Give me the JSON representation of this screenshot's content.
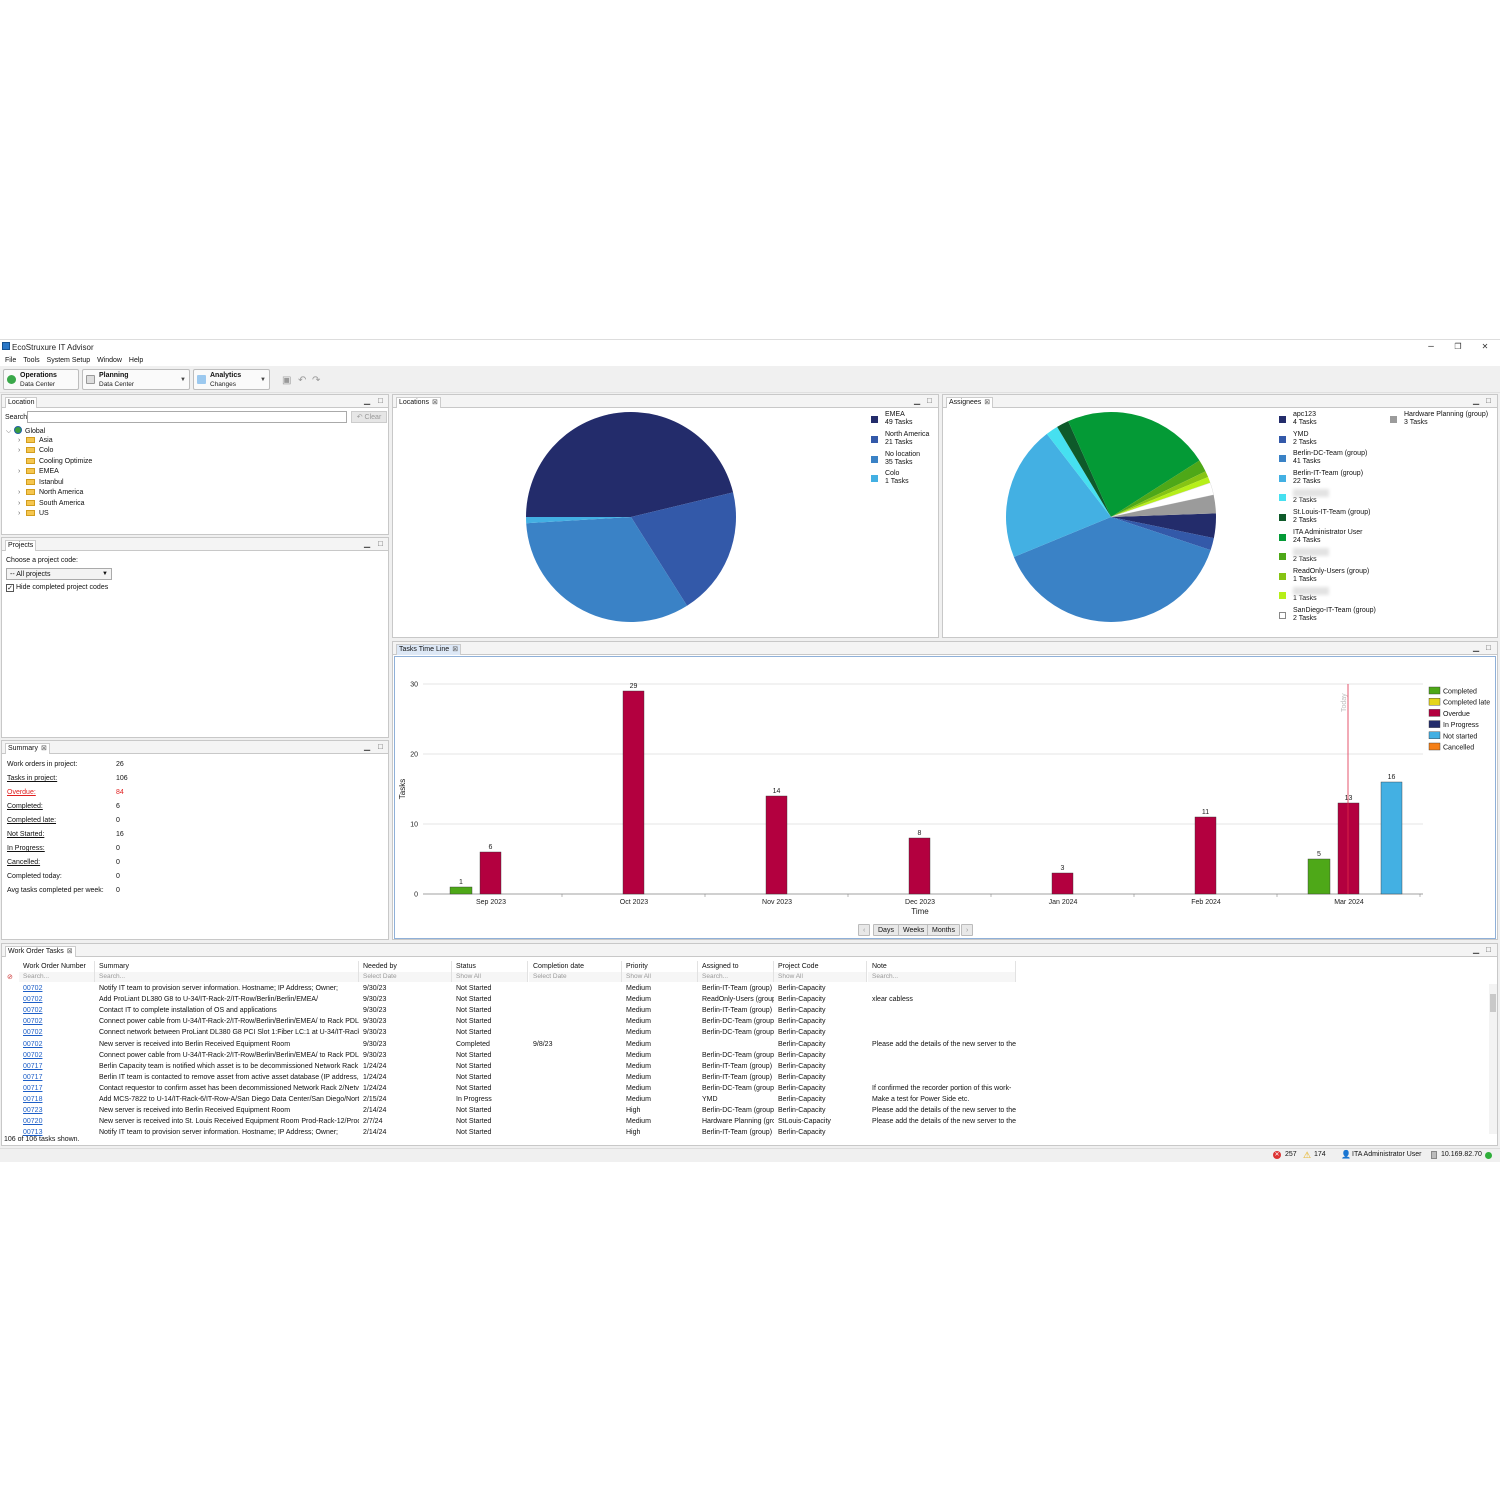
{
  "window": {
    "title": "EcoStruxure IT Advisor",
    "minimize": "–",
    "restore": "❐",
    "close": "✕"
  },
  "menu": [
    "File",
    "Tools",
    "System Setup",
    "Window",
    "Help"
  ],
  "perspectives": [
    {
      "title": "Operations",
      "subtitle": "Data Center",
      "color": "#3aa84a"
    },
    {
      "title": "Planning",
      "subtitle": "Data Center",
      "color": "#8a8a8a"
    },
    {
      "title": "Analytics",
      "subtitle": "Changes",
      "color": "#3d8fd6"
    }
  ],
  "location": {
    "tab": "Location",
    "search_label": "Search:",
    "search_value": "",
    "clear_label": "Clear",
    "tree": [
      {
        "label": "Global",
        "level": 0,
        "expanded": true
      },
      {
        "label": "Asia",
        "level": 1,
        "arrow": true
      },
      {
        "label": "Colo",
        "level": 1,
        "arrow": true
      },
      {
        "label": "Cooling Optimize",
        "level": 1,
        "arrow": false
      },
      {
        "label": "EMEA",
        "level": 1,
        "arrow": true
      },
      {
        "label": "Istanbul",
        "level": 1,
        "arrow": false
      },
      {
        "label": "North America",
        "level": 1,
        "arrow": true
      },
      {
        "label": "South America",
        "level": 1,
        "arrow": true
      },
      {
        "label": "US",
        "level": 1,
        "arrow": true
      }
    ]
  },
  "projects": {
    "tab": "Projects",
    "choose_label": "Choose a project code:",
    "select_value": "-- All projects",
    "hide_completed_label": "Hide completed project codes",
    "hide_completed_checked": true
  },
  "summary": {
    "tab": "Summary",
    "rows": [
      {
        "label": "Work orders in project:",
        "value": "26",
        "underline": false,
        "red": false
      },
      {
        "label": "Tasks in project:",
        "value": "106",
        "underline": true,
        "red": false
      },
      {
        "label": "Overdue:",
        "value": "84",
        "underline": true,
        "red": true
      },
      {
        "label": "Completed:",
        "value": "6",
        "underline": true,
        "red": false
      },
      {
        "label": "Completed late:",
        "value": "0",
        "underline": true,
        "red": false
      },
      {
        "label": "Not Started:",
        "value": "16",
        "underline": true,
        "red": false
      },
      {
        "label": "In Progress:",
        "value": "0",
        "underline": true,
        "red": false
      },
      {
        "label": "Cancelled:",
        "value": "0",
        "underline": true,
        "red": false
      },
      {
        "label": "Completed today:",
        "value": "0",
        "underline": false,
        "red": false
      },
      {
        "label": "Avg tasks completed per week:",
        "value": "0",
        "underline": false,
        "red": false
      }
    ]
  },
  "locations_chart": {
    "tab": "Locations",
    "legend": [
      {
        "name": "EMEA",
        "tasks": "49 Tasks",
        "value": 49,
        "color": "#232c6b"
      },
      {
        "name": "North America",
        "tasks": "21 Tasks",
        "value": 21,
        "color": "#3359a9"
      },
      {
        "name": "No location",
        "tasks": "35 Tasks",
        "value": 35,
        "color": "#3a82c6"
      },
      {
        "name": "Colo",
        "tasks": "1 Tasks",
        "value": 1,
        "color": "#43b0e3"
      }
    ]
  },
  "assignees_chart": {
    "tab": "Assignees",
    "legend": [
      {
        "name": "apc123",
        "tasks": "4 Tasks",
        "value": 4,
        "color": "#232c6b"
      },
      {
        "name": "YMD",
        "tasks": "2 Tasks",
        "value": 2,
        "color": "#3359a9"
      },
      {
        "name": "Berlin-DC-Team (group)",
        "tasks": "41 Tasks",
        "value": 41,
        "color": "#3a82c6"
      },
      {
        "name": "Berlin-IT-Team (group)",
        "tasks": "22 Tasks",
        "value": 22,
        "color": "#43b0e3"
      },
      {
        "name": "",
        "tasks": "2 Tasks",
        "value": 2,
        "color": "#46e0f0",
        "blurred": true
      },
      {
        "name": "St.Louis-IT-Team (group)",
        "tasks": "2 Tasks",
        "value": 2,
        "color": "#0e5a2a"
      },
      {
        "name": "ITA Administrator User",
        "tasks": "24 Tasks",
        "value": 24,
        "color": "#049a36"
      },
      {
        "name": "",
        "tasks": "2 Tasks",
        "value": 2,
        "color": "#4ea818",
        "blurred": true
      },
      {
        "name": "ReadOnly-Users (group)",
        "tasks": "1 Tasks",
        "value": 1,
        "color": "#86c414"
      },
      {
        "name": "",
        "tasks": "1 Tasks",
        "value": 1,
        "color": "#b6ef19",
        "blurred": true
      },
      {
        "name": "SanDiego-IT-Team (group)",
        "tasks": "2 Tasks",
        "value": 2,
        "color": "#ffffff"
      },
      {
        "name": "Hardware Planning (group)",
        "tasks": "3 Tasks",
        "value": 3,
        "color": "#9b9b9b"
      }
    ]
  },
  "timeline": {
    "tab": "Tasks Time Line",
    "today_label": "Today",
    "nav": {
      "prev": "‹",
      "next": "›",
      "days": "Days",
      "weeks": "Weeks",
      "months": "Months"
    }
  },
  "chart_data": {
    "type": "bar",
    "xlabel": "Time",
    "ylabel": "Tasks",
    "ylim": [
      0,
      30
    ],
    "yticks": [
      0,
      10,
      20,
      30
    ],
    "categories": [
      "Sep 2023",
      "Oct 2023",
      "Nov 2023",
      "Dec 2023",
      "Jan 2024",
      "Feb 2024",
      "Mar 2024"
    ],
    "bars": [
      {
        "month": "Sep 2023",
        "series": "Completed",
        "value": 1
      },
      {
        "month": "Sep 2023",
        "series": "Overdue",
        "value": 6
      },
      {
        "month": "Oct 2023",
        "series": "Overdue",
        "value": 29
      },
      {
        "month": "Nov 2023",
        "series": "Overdue",
        "value": 14
      },
      {
        "month": "Dec 2023",
        "series": "Overdue",
        "value": 8
      },
      {
        "month": "Jan 2024",
        "series": "Overdue",
        "value": 3
      },
      {
        "month": "Feb 2024",
        "series": "Overdue",
        "value": 11
      },
      {
        "month": "Mar 2024",
        "series": "Completed",
        "value": 5
      },
      {
        "month": "Mar 2024",
        "series": "Overdue",
        "value": 13
      },
      {
        "month": "Mar 2024",
        "series": "Not started",
        "value": 16
      }
    ],
    "legend": [
      {
        "name": "Completed",
        "color": "#4ea818"
      },
      {
        "name": "Completed late",
        "color": "#e5d51a"
      },
      {
        "name": "Overdue",
        "color": "#b3003f"
      },
      {
        "name": "In Progress",
        "color": "#232c6b"
      },
      {
        "name": "Not started",
        "color": "#43b0e3"
      },
      {
        "name": "Cancelled",
        "color": "#f57f17"
      }
    ],
    "legend_position": "right",
    "grid": true
  },
  "work_orders": {
    "tab": "Work Order Tasks",
    "columns": [
      "Work Order Number",
      "Summary",
      "Needed by",
      "Status",
      "Completion date",
      "Priority",
      "Assigned to",
      "Project Code",
      "Note"
    ],
    "filters": [
      "Search...",
      "Search...",
      "Select Date",
      "Show All",
      "Select Date",
      "Show All",
      "Search...",
      "Show All",
      "Search..."
    ],
    "rows": [
      [
        "00702",
        "Notify IT team to provision server information. Hostname; IP Address; Owner;",
        "9/30/23",
        "Not Started",
        "",
        "Medium",
        "Berlin-IT-Team (group)",
        "Berlin-Capacity",
        ""
      ],
      [
        "00702",
        "Add ProLiant DL380 G8 to U-34/IT-Rack-2/IT-Row/Berlin/Berlin/EMEA/",
        "9/30/23",
        "Not Started",
        "",
        "Medium",
        "ReadOnly-Users (group",
        "Berlin-Capacity",
        "xlear cabless"
      ],
      [
        "00702",
        "Contact IT to complete installation of OS and applications",
        "9/30/23",
        "Not Started",
        "",
        "Medium",
        "Berlin-IT-Team (group)",
        "Berlin-Capacity",
        ""
      ],
      [
        "00702",
        "Connect power cable from U-34/IT-Rack-2/IT-Row/Berlin/Berlin/EMEA/ to Rack PDL",
        "9/30/23",
        "Not Started",
        "",
        "Medium",
        "Berlin-DC-Team (group",
        "Berlin-Capacity",
        ""
      ],
      [
        "00702",
        "Connect network between ProLiant DL380 G8 PCI Slot 1:Fiber LC:1 at U-34/IT-Rack-2,",
        "9/30/23",
        "Not Started",
        "",
        "Medium",
        "Berlin-DC-Team (group",
        "Berlin-Capacity",
        ""
      ],
      [
        "00702",
        "New server is received into Berlin Received Equipment Room",
        "9/30/23",
        "Completed",
        "9/8/23",
        "Medium",
        "",
        "Berlin-Capacity",
        "Please add the details of the new server to the"
      ],
      [
        "00702",
        "Connect power cable from U-34/IT-Rack-2/IT-Row/Berlin/Berlin/EMEA/ to Rack PDL",
        "9/30/23",
        "Not Started",
        "",
        "Medium",
        "Berlin-DC-Team (group",
        "Berlin-Capacity",
        ""
      ],
      [
        "00717",
        "Berlin Capacity team is notified which asset is to be decommissioned  Network Rack",
        "1/24/24",
        "Not Started",
        "",
        "Medium",
        "Berlin-IT-Team (group)",
        "Berlin-Capacity",
        ""
      ],
      [
        "00717",
        "Berlin IT team is contacted to remove asset from active asset database (IP address, ar",
        "1/24/24",
        "Not Started",
        "",
        "Medium",
        "Berlin-IT-Team (group)",
        "Berlin-Capacity",
        ""
      ],
      [
        "00717",
        "Contact requestor to confirm asset has been decommissioned  Network Rack 2/Netv",
        "1/24/24",
        "Not Started",
        "",
        "Medium",
        "Berlin-DC-Team (group",
        "Berlin-Capacity",
        "If confirmed the recorder portion of this work-"
      ],
      [
        "00718",
        "Add MCS-7822 to U-14/IT-Rack-6/IT-Row-A/San Diego Data Center/San Diego/Nortl",
        "2/15/24",
        "In Progress",
        "",
        "Medium",
        "YMD",
        "Berlin-Capacity",
        "Make a test for Power Side etc."
      ],
      [
        "00723",
        "New server is received into Berlin Received Equipment Room",
        "2/14/24",
        "Not Started",
        "",
        "High",
        "Berlin-DC-Team (group",
        "Berlin-Capacity",
        "Please add the details of the new server to the"
      ],
      [
        "00720",
        "New server is received into St. Louis Received Equipment Room  Prod-Rack-12/Prod",
        "2/7/24",
        "Not Started",
        "",
        "Medium",
        "Hardware Planning (grc",
        "StLouis-Capacity",
        "Please add the details of the new server to the"
      ],
      [
        "00713",
        "Notify IT team to provision server information. Hostname; IP Address; Owner;",
        "2/14/24",
        "Not Started",
        "",
        "High",
        "Berlin-IT-Team (group)",
        "Berlin-Capacity",
        ""
      ]
    ],
    "footer": "106 of 106 tasks shown."
  },
  "status": {
    "errors": "257",
    "warnings": "174",
    "user": "ITA Administrator User",
    "ip": "10.169.82.70"
  }
}
